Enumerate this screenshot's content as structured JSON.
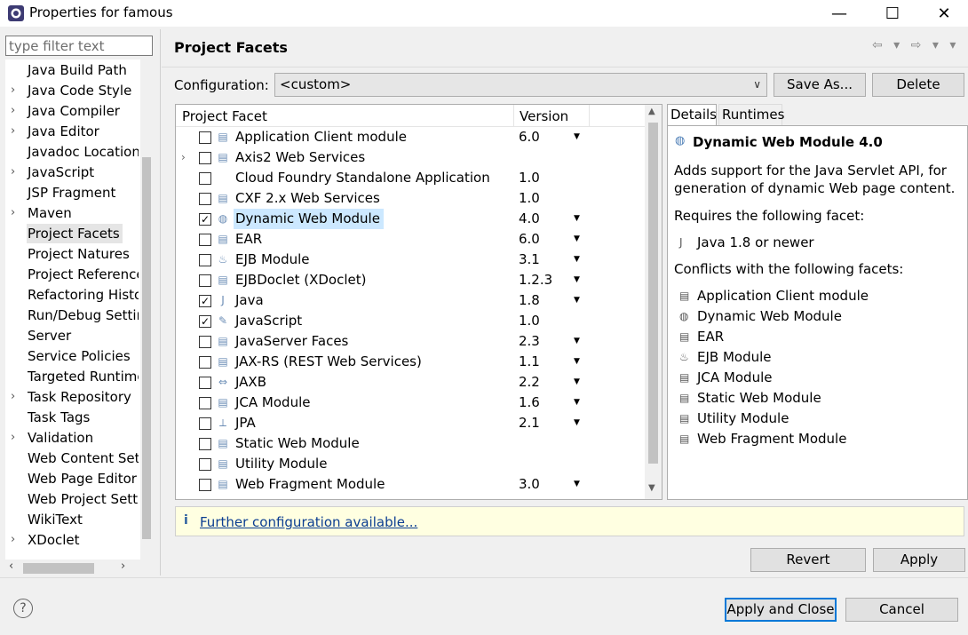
{
  "window": {
    "title": "Properties for famous",
    "minimize": "—",
    "maximize": "☐",
    "close": "✕"
  },
  "filter": {
    "placeholder": "type filter text"
  },
  "tree": {
    "items": [
      {
        "label": "Java Build Path",
        "expandable": false
      },
      {
        "label": "Java Code Style",
        "expandable": true
      },
      {
        "label": "Java Compiler",
        "expandable": true
      },
      {
        "label": "Java Editor",
        "expandable": true
      },
      {
        "label": "Javadoc Location",
        "expandable": false
      },
      {
        "label": "JavaScript",
        "expandable": true
      },
      {
        "label": "JSP Fragment",
        "expandable": false
      },
      {
        "label": "Maven",
        "expandable": true
      },
      {
        "label": "Project Facets",
        "expandable": false,
        "selected": true
      },
      {
        "label": "Project Natures",
        "expandable": false
      },
      {
        "label": "Project References",
        "expandable": false
      },
      {
        "label": "Refactoring History",
        "expandable": false
      },
      {
        "label": "Run/Debug Settings",
        "expandable": false
      },
      {
        "label": "Server",
        "expandable": false
      },
      {
        "label": "Service Policies",
        "expandable": false
      },
      {
        "label": "Targeted Runtimes",
        "expandable": false
      },
      {
        "label": "Task Repository",
        "expandable": true
      },
      {
        "label": "Task Tags",
        "expandable": false
      },
      {
        "label": "Validation",
        "expandable": true
      },
      {
        "label": "Web Content Settings",
        "expandable": false
      },
      {
        "label": "Web Page Editor",
        "expandable": false
      },
      {
        "label": "Web Project Settings",
        "expandable": false
      },
      {
        "label": "WikiText",
        "expandable": false
      },
      {
        "label": "XDoclet",
        "expandable": true
      }
    ]
  },
  "page": {
    "title": "Project Facets",
    "nav": "⇦ ▾ ⇨ ▾ ▾"
  },
  "configuration": {
    "label": "Configuration:",
    "value": "<custom>",
    "save_as": "Save As...",
    "delete": "Delete"
  },
  "facets": {
    "header_facet": "Project Facet",
    "header_version": "Version",
    "rows": [
      {
        "name": "Application Client module",
        "version": "6.0",
        "checked": false,
        "dropdown": true,
        "icon": "page-icon"
      },
      {
        "name": "Axis2 Web Services",
        "version": "",
        "checked": false,
        "dropdown": false,
        "expandable": true,
        "icon": "page-icon"
      },
      {
        "name": "Cloud Foundry Standalone Application",
        "version": "1.0",
        "checked": false,
        "dropdown": false,
        "icon": "none"
      },
      {
        "name": "CXF 2.x Web Services",
        "version": "1.0",
        "checked": false,
        "dropdown": false,
        "icon": "page-icon"
      },
      {
        "name": "Dynamic Web Module",
        "version": "4.0",
        "checked": true,
        "dropdown": true,
        "highlight": true,
        "icon": "globe-icon"
      },
      {
        "name": "EAR",
        "version": "6.0",
        "checked": false,
        "dropdown": true,
        "icon": "page-icon"
      },
      {
        "name": "EJB Module",
        "version": "3.1",
        "checked": false,
        "dropdown": true,
        "icon": "bean-icon"
      },
      {
        "name": "EJBDoclet (XDoclet)",
        "version": "1.2.3",
        "checked": false,
        "dropdown": true,
        "icon": "page-icon"
      },
      {
        "name": "Java",
        "version": "1.8",
        "checked": true,
        "dropdown": true,
        "icon": "java-icon"
      },
      {
        "name": "JavaScript",
        "version": "1.0",
        "checked": true,
        "dropdown": false,
        "icon": "script-icon"
      },
      {
        "name": "JavaServer Faces",
        "version": "2.3",
        "checked": false,
        "dropdown": true,
        "icon": "page-icon"
      },
      {
        "name": "JAX-RS (REST Web Services)",
        "version": "1.1",
        "checked": false,
        "dropdown": true,
        "icon": "page-icon"
      },
      {
        "name": "JAXB",
        "version": "2.2",
        "checked": false,
        "dropdown": true,
        "icon": "jaxb-icon"
      },
      {
        "name": "JCA Module",
        "version": "1.6",
        "checked": false,
        "dropdown": true,
        "icon": "page-icon"
      },
      {
        "name": "JPA",
        "version": "2.1",
        "checked": false,
        "dropdown": true,
        "icon": "jpa-icon"
      },
      {
        "name": "Static Web Module",
        "version": "",
        "checked": false,
        "dropdown": false,
        "icon": "page-icon"
      },
      {
        "name": "Utility Module",
        "version": "",
        "checked": false,
        "dropdown": false,
        "icon": "page-icon"
      },
      {
        "name": "Web Fragment Module",
        "version": "3.0",
        "checked": false,
        "dropdown": true,
        "icon": "page-icon"
      }
    ]
  },
  "details": {
    "tab_details": "Details",
    "tab_runtimes": "Runtimes",
    "title": "Dynamic Web Module 4.0",
    "description": "Adds support for the Java Servlet API, for generation of dynamic Web page content.",
    "requires_label": "Requires the following facet:",
    "requires": [
      "Java 1.8 or newer"
    ],
    "conflicts_label": "Conflicts with the following facets:",
    "conflicts": [
      "Application Client module",
      "Dynamic Web Module",
      "EAR",
      "EJB Module",
      "JCA Module",
      "Static Web Module",
      "Utility Module",
      "Web Fragment Module"
    ]
  },
  "info": {
    "icon": "i",
    "link": "Further configuration available..."
  },
  "buttons": {
    "revert": "Revert",
    "apply": "Apply",
    "apply_and_close": "Apply and Close",
    "cancel": "Cancel",
    "help": "?"
  }
}
